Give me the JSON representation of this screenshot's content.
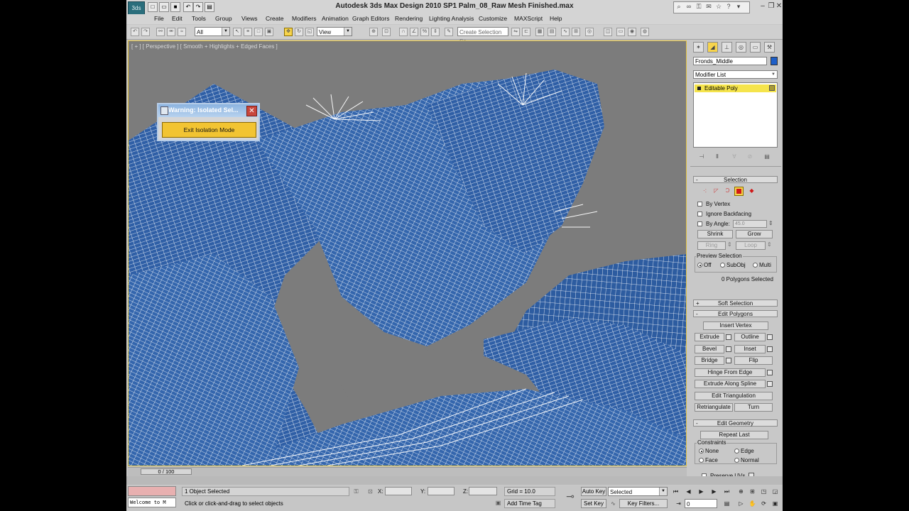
{
  "title": "Autodesk 3ds Max Design 2010 SP1      Palm_08_Raw Mesh Finished.max",
  "app_logo": "3ds",
  "menu": [
    "File",
    "Edit",
    "Tools",
    "Group",
    "Views",
    "Create",
    "Modifiers",
    "Animation",
    "Graph Editors",
    "Rendering",
    "Lighting Analysis",
    "Customize",
    "MAXScript",
    "Help"
  ],
  "toolbar": {
    "selection_filter": "All",
    "ref_coord": "View",
    "named_selection_placeholder": "Create Selection Se"
  },
  "viewport": {
    "label": "[ + ] [ Perspective ] [ Smooth + Highlights + Edged Faces ]"
  },
  "warning": {
    "title": "Warning: Isolated Sel...",
    "button": "Exit Isolation Mode"
  },
  "command_panel": {
    "object_name": "Fronds_Middle",
    "object_color": "#1e5fc8",
    "modifier_list": "Modifier List",
    "stack_item": "Editable Poly",
    "selection": {
      "title": "Selection",
      "by_vertex": "By Vertex",
      "ignore_backfacing": "Ignore Backfacing",
      "by_angle": "By Angle:",
      "angle_value": "45.0",
      "shrink": "Shrink",
      "grow": "Grow",
      "ring": "Ring",
      "loop": "Loop",
      "preview_selection": "Preview Selection",
      "off": "Off",
      "subobj": "SubObj",
      "multi": "Multi",
      "status": "0 Polygons Selected"
    },
    "soft_selection": "Soft Selection",
    "edit_polygons": {
      "title": "Edit Polygons",
      "insert_vertex": "Insert Vertex",
      "extrude": "Extrude",
      "outline": "Outline",
      "bevel": "Bevel",
      "inset": "Inset",
      "bridge": "Bridge",
      "flip": "Flip",
      "hinge": "Hinge From Edge",
      "extrude_spline": "Extrude Along Spline",
      "edit_triangulation": "Edit Triangulation",
      "retriangulate": "Retriangulate",
      "turn": "Turn"
    },
    "edit_geometry": {
      "title": "Edit Geometry",
      "repeat_last": "Repeat Last",
      "constraints": "Constraints",
      "none": "None",
      "edge": "Edge",
      "face": "Face",
      "normal": "Normal",
      "preserve_uvs": "Preserve UVs"
    }
  },
  "timeline": {
    "slider": "0 / 100"
  },
  "status": {
    "maxscript": "Welcome to M",
    "selected": "1 Object Selected",
    "prompt": "Click or click-and-drag to select objects",
    "x_label": "X:",
    "y_label": "Y:",
    "z_label": "Z:",
    "grid": "Grid = 10.0",
    "add_time_tag": "Add Time Tag",
    "auto_key": "Auto Key",
    "set_key": "Set Key",
    "key_mode": "Selected",
    "key_filters": "Key Filters...",
    "frame": "0"
  },
  "colors": {
    "mesh_fill": "#2f5fa6",
    "mesh_wire": "#ffffff",
    "accent": "#f2c432"
  }
}
